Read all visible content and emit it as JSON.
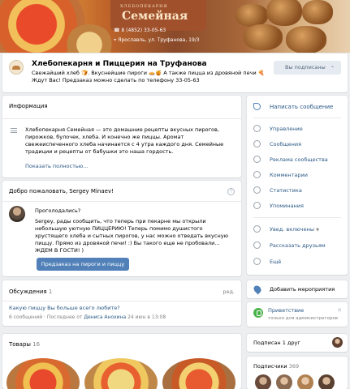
{
  "cover": {
    "logo_top": "ХЛЕБОПЕКАРНЯ",
    "logo_main": "Семейная",
    "phone": "8 (4852) 33-05-63",
    "address": "Ярославль, ул. Труфанова, 19/3"
  },
  "header": {
    "title": "Хлебопекарня и Пиццерия на Труфанова",
    "status": "Свежайший хлеб 🍞. Вкуснейшие пироги 🥧🍯 А также пицца из дровяной печи 🍕 Ждут Вас! Предзаказ можно сделать по телефону 33-05-63",
    "subscribe_label": "Вы подписаны",
    "subscribe_chevron": "⌄"
  },
  "info": {
    "heading": "Информация",
    "text": "Хлебопекарня Семейная — это домашние рецепты вкусных пирогов, пирожков, булочек, хлеба. И конечно же пиццы. Аромат свежеиспеченного хлеба начинается с 4 утра каждого дня. Семейные традиции и рецепты от бабушки это наша гордость.",
    "more_link": "Показать полностью…"
  },
  "welcome": {
    "heading": "Добро пожаловать, Sergey Minaev!",
    "help": "?",
    "greeting": "Проголодались?",
    "message": "Sergey, рады сообщить, что теперь при пекарне мы открыли небольшую уютную ПИЦЦЕРИЮ! Теперь помимо душистого хрустящего хлеба и сытных пирогов, у нас можно отведать вкусную пиццу. Прямо из дровяной печи! :) Вы такого еще не пробовали... ЖДЕМ В ГОСТИ! )",
    "button": "Предзаказ на пироги и пиццу"
  },
  "discussions": {
    "heading": "Обсуждения",
    "count": "1",
    "edit": "ред.",
    "topic": "Какую пиццу Вы больше всего любите?",
    "meta_count": "6 сообщений",
    "meta_last": "Последнее от",
    "meta_author": "Дениса Анохина",
    "meta_date": "24 июн в 13:08"
  },
  "goods": {
    "heading": "Товары",
    "count": "16"
  },
  "menu": {
    "items": [
      {
        "label": "Написать сообщение"
      },
      {
        "label": "Управление"
      },
      {
        "label": "Сообщения"
      },
      {
        "label": "Реклама сообщества"
      },
      {
        "label": "Комментарии"
      },
      {
        "label": "Статистика"
      },
      {
        "label": "Упоминания"
      },
      {
        "label": "Увед. включены"
      },
      {
        "label": "Рассказать друзьям"
      },
      {
        "label": "Ещё"
      }
    ]
  },
  "event": {
    "label": "Добавить мероприятия"
  },
  "greeting_app": {
    "title": "Приветствие",
    "subtitle": "только для администраторов",
    "close": "✕"
  },
  "friends": {
    "label": "Подписан 1 друг"
  },
  "subscribers": {
    "heading": "Подписчики",
    "count": "369"
  },
  "colors": {
    "accent": "#5181b8",
    "link": "#2a5885",
    "background": "#edeef0"
  },
  "icons": [
    "house-icon",
    "chat-icon",
    "gear-icon",
    "megaphone-icon",
    "comment-icon",
    "chart-icon",
    "at-icon",
    "bell-icon",
    "megaphone-icon",
    "more-icon",
    "map-pin-icon",
    "phone-icon"
  ]
}
